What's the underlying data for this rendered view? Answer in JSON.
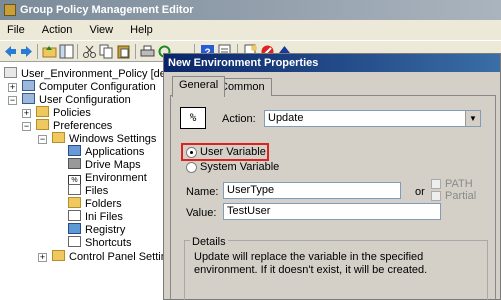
{
  "window": {
    "title": "Group Policy Management Editor"
  },
  "menu": [
    "File",
    "Action",
    "View",
    "Help"
  ],
  "tree": {
    "root": "User_Environment_Policy [devDC.V",
    "computer_config": "Computer Configuration",
    "user_config": "User Configuration",
    "policies": "Policies",
    "preferences": "Preferences",
    "windows_settings": "Windows Settings",
    "items": [
      "Applications",
      "Drive Maps",
      "Environment",
      "Files",
      "Folders",
      "Ini Files",
      "Registry",
      "Shortcuts"
    ],
    "control_panel": "Control Panel Settings"
  },
  "dialog": {
    "title": "New Environment Properties",
    "tabs": [
      "General",
      "Common"
    ],
    "action_label": "Action:",
    "action_value": "Update",
    "radio_user": "User Variable",
    "radio_system": "System Variable",
    "name_label": "Name:",
    "name_value": "UserType",
    "or_label": "or",
    "path_label": "PATH",
    "partial_label": "Partial",
    "value_label": "Value:",
    "value_value": "TestUser",
    "details_title": "Details",
    "details_text": "Update will replace the variable in the specified environment. If it doesn't exist, it will be created."
  },
  "colors": {
    "highlight": "#dd2222",
    "title_bar": "#0a246a"
  }
}
